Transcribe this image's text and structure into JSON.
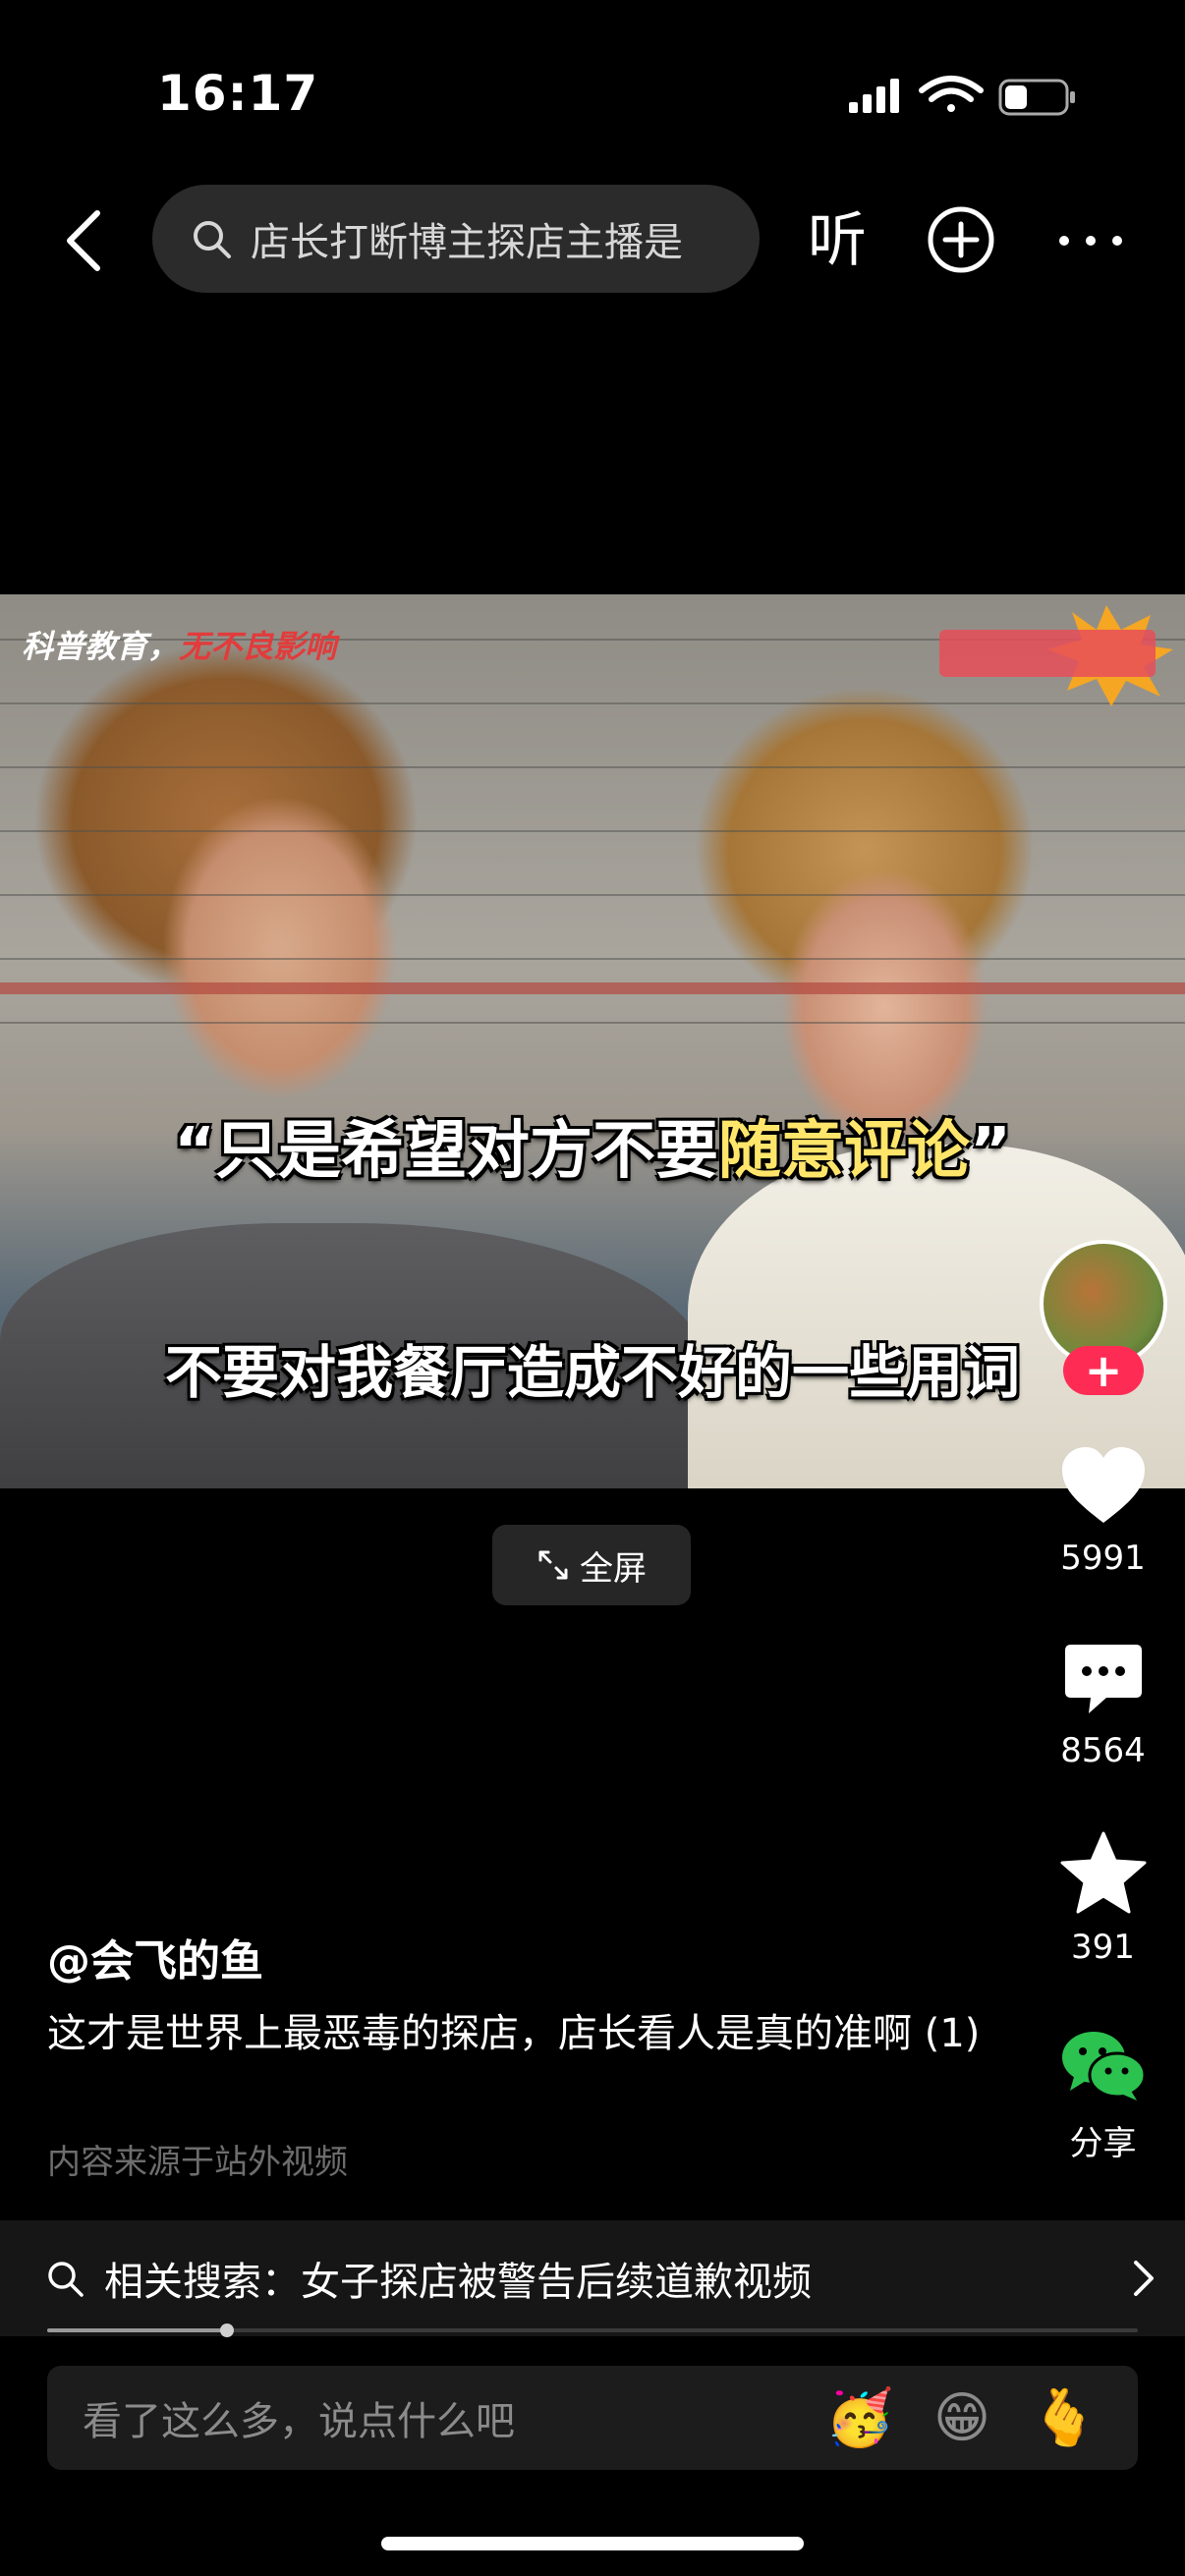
{
  "status_bar": {
    "time": "16:17"
  },
  "top_nav": {
    "search_text": "店长打断博主探店主播是",
    "listen_label": "听"
  },
  "video": {
    "sign_left_white": "科普教育，",
    "sign_left_red": "无不良影响",
    "subtitle_1_part_a": "“只是希望对方不要",
    "subtitle_1_highlight": "随意评论",
    "subtitle_1_part_b": "”",
    "subtitle_2": "不要对我餐厅造成不好的一些用词"
  },
  "fullscreen": {
    "label": "全屏"
  },
  "actions": {
    "follow_plus": "+",
    "like_count": "5991",
    "comment_count": "8564",
    "favorite_count": "391",
    "share_label": "分享"
  },
  "post": {
    "author": "@会飞的鱼",
    "caption": "这才是世界上最恶毒的探店，店长看人是真的准啊 (1)",
    "source_note": "内容来源于站外视频"
  },
  "related_search": {
    "text": "相关搜索：女子探店被警告后续道歉视频"
  },
  "playback": {
    "progress": 0.165
  },
  "comment_bar": {
    "placeholder": "看了这么多，说点什么吧",
    "emojis": [
      "🥳",
      "😁",
      "🫰"
    ]
  },
  "colors": {
    "accent_red": "#fe2c55",
    "share_green": "#2bc24f",
    "subtitle_highlight": "#ffe66b"
  }
}
